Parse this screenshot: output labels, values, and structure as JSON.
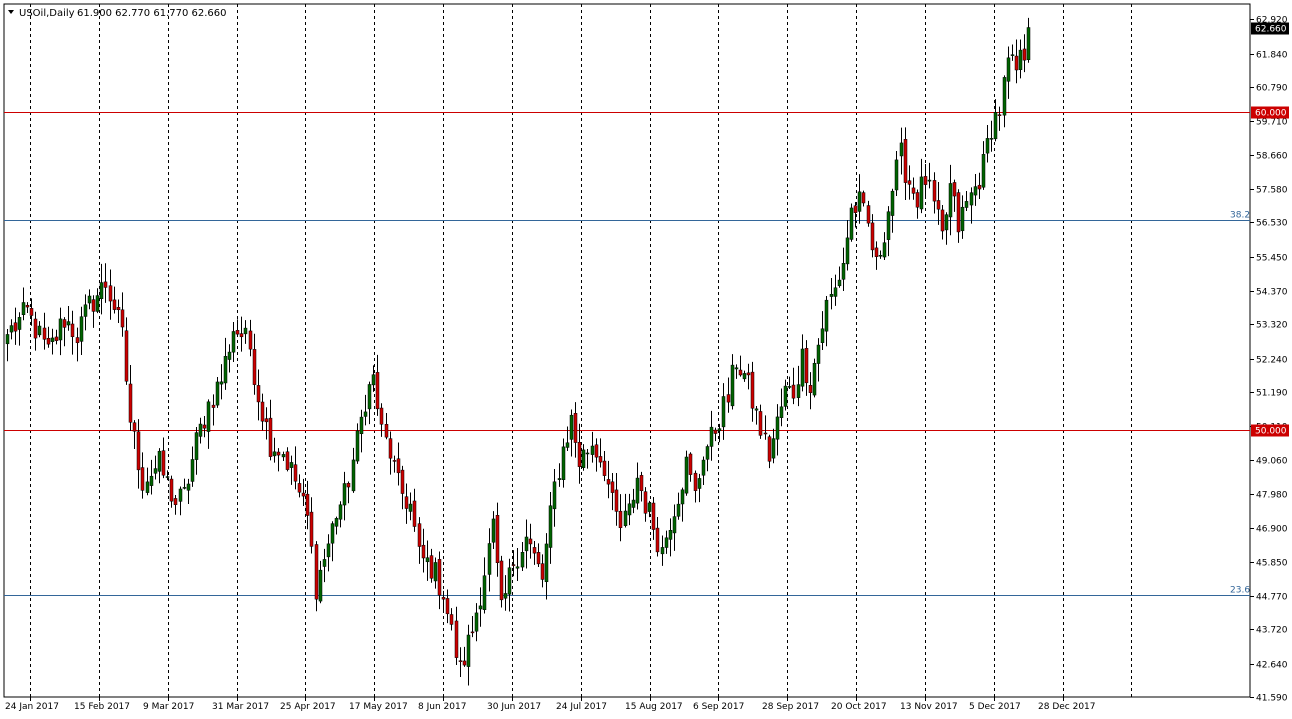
{
  "chart_header": {
    "symbol_label": "USOil,Daily",
    "ohlc_text": "61.900 62.770 61.770 62.660"
  },
  "chart_data": {
    "type": "candlestick",
    "symbol": "USOil",
    "timeframe": "Daily",
    "last_price_label": "62.660",
    "ylim": [
      41.59,
      63.4
    ],
    "y_tick_labels": [
      "62.920",
      "61.840",
      "60.790",
      "59.710",
      "58.660",
      "57.580",
      "56.530",
      "55.450",
      "54.370",
      "53.320",
      "52.240",
      "51.190",
      "50.110",
      "49.060",
      "47.980",
      "46.900",
      "45.850",
      "44.770",
      "43.720",
      "42.640",
      "41.590"
    ],
    "x_tick_labels": [
      "24 Jan 2017",
      "15 Feb 2017",
      "9 Mar 2017",
      "31 Mar 2017",
      "25 Apr 2017",
      "17 May 2017",
      "8 Jun 2017",
      "30 Jun 2017",
      "24 Jul 2017",
      "15 Aug 2017",
      "6 Sep 2017",
      "28 Sep 2017",
      "20 Oct 2017",
      "13 Nov 2017",
      "5 Dec 2017",
      "28 Dec 2017"
    ],
    "horizontal_levels": [
      {
        "label": "60.000",
        "value": 60.0,
        "color": "#cc0000",
        "label_style": "box"
      },
      {
        "label": "50.000",
        "value": 50.0,
        "color": "#cc0000",
        "label_style": "box"
      },
      {
        "label": "38.2",
        "value": 56.6,
        "color": "#336699",
        "label_style": "text"
      },
      {
        "label": "23.6",
        "value": 44.8,
        "color": "#336699",
        "label_style": "text"
      }
    ],
    "colors": {
      "bull_body": "#006400",
      "bear_body": "#cc0000",
      "wick": "#000000",
      "grid": "#000000",
      "last_price_bg": "#000000",
      "last_price_fg": "#ffffff"
    },
    "candle_count": 260,
    "waypoints": [
      [
        0,
        53.0
      ],
      [
        5,
        53.7
      ],
      [
        10,
        52.4
      ],
      [
        14,
        53.5
      ],
      [
        17,
        53.0
      ],
      [
        20,
        53.9
      ],
      [
        24,
        54.6
      ],
      [
        26,
        53.9
      ],
      [
        28,
        52.9
      ],
      [
        30,
        50.3
      ],
      [
        33,
        48.4
      ],
      [
        37,
        48.9
      ],
      [
        41,
        47.7
      ],
      [
        43,
        47.9
      ],
      [
        46,
        49.6
      ],
      [
        49,
        50.8
      ],
      [
        52,
        51.6
      ],
      [
        55,
        53.2
      ],
      [
        57,
        53.0
      ],
      [
        59,
        52.6
      ],
      [
        61,
        51.1
      ],
      [
        64,
        49.6
      ],
      [
        67,
        49.3
      ],
      [
        70,
        48.4
      ],
      [
        73,
        47.2
      ],
      [
        75,
        45.1
      ],
      [
        78,
        46.4
      ],
      [
        80,
        47.4
      ],
      [
        82,
        47.9
      ],
      [
        85,
        49.6
      ],
      [
        87,
        51.0
      ],
      [
        89,
        51.6
      ],
      [
        91,
        49.9
      ],
      [
        93,
        49.3
      ],
      [
        95,
        48.2
      ],
      [
        98,
        47.6
      ],
      [
        100,
        46.0
      ],
      [
        103,
        45.7
      ],
      [
        106,
        44.9
      ],
      [
        108,
        43.6
      ],
      [
        110,
        42.4
      ],
      [
        113,
        43.7
      ],
      [
        115,
        44.9
      ],
      [
        118,
        46.9
      ],
      [
        120,
        44.2
      ],
      [
        123,
        45.9
      ],
      [
        126,
        46.6
      ],
      [
        130,
        45.3
      ],
      [
        133,
        48.2
      ],
      [
        135,
        49.4
      ],
      [
        137,
        50.3
      ],
      [
        139,
        49.0
      ],
      [
        142,
        49.6
      ],
      [
        145,
        48.9
      ],
      [
        147,
        47.6
      ],
      [
        149,
        46.9
      ],
      [
        151,
        47.4
      ],
      [
        153,
        48.5
      ],
      [
        155,
        47.7
      ],
      [
        157,
        47.0
      ],
      [
        159,
        46.2
      ],
      [
        161,
        47.2
      ],
      [
        163,
        48.0
      ],
      [
        165,
        48.9
      ],
      [
        167,
        47.9
      ],
      [
        169,
        49.3
      ],
      [
        171,
        49.7
      ],
      [
        173,
        50.4
      ],
      [
        175,
        51.0
      ],
      [
        177,
        52.2
      ],
      [
        179,
        51.7
      ],
      [
        181,
        50.9
      ],
      [
        183,
        50.0
      ],
      [
        185,
        49.2
      ],
      [
        187,
        50.2
      ],
      [
        189,
        51.2
      ],
      [
        191,
        51.2
      ],
      [
        193,
        52.3
      ],
      [
        195,
        51.5
      ],
      [
        197,
        52.7
      ],
      [
        199,
        53.9
      ],
      [
        201,
        54.4
      ],
      [
        203,
        55.3
      ],
      [
        205,
        56.9
      ],
      [
        207,
        57.1
      ],
      [
        209,
        56.4
      ],
      [
        211,
        55.1
      ],
      [
        213,
        56.3
      ],
      [
        215,
        57.6
      ],
      [
        217,
        58.6
      ],
      [
        219,
        57.8
      ],
      [
        221,
        57.3
      ],
      [
        223,
        57.9
      ],
      [
        225,
        57.0
      ],
      [
        227,
        56.0
      ],
      [
        229,
        57.6
      ],
      [
        231,
        56.4
      ],
      [
        233,
        57.1
      ],
      [
        235,
        57.6
      ],
      [
        237,
        58.3
      ],
      [
        239,
        59.6
      ],
      [
        241,
        60.1
      ],
      [
        243,
        61.5
      ],
      [
        245,
        61.3
      ],
      [
        247,
        61.9
      ],
      [
        248,
        62.66
      ]
    ]
  }
}
